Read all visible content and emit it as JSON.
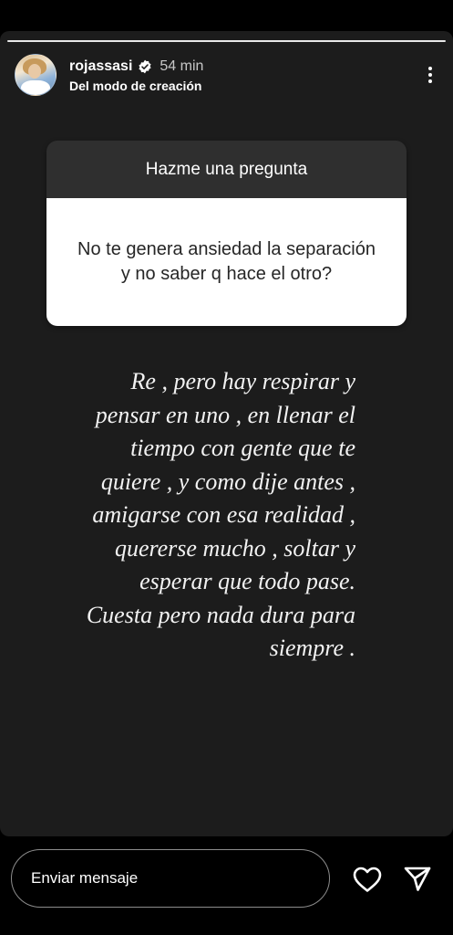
{
  "story": {
    "progress_segments": 1,
    "username": "rojassasi",
    "verified": true,
    "time_ago": "54 min",
    "subtitle": "Del modo de creación",
    "menu_icon": "more-vertical-icon"
  },
  "question_sticker": {
    "title": "Hazme una pregunta",
    "question": "No te genera ansiedad la separación y no saber q hace el otro?"
  },
  "answer_lines": [
    "Re , pero hay respirar y",
    "pensar en uno , en llenar el",
    "tiempo con gente que te",
    "quiere ,  y como dije antes ,",
    "amigarse con esa realidad  ,",
    "quererse mucho , soltar y",
    "esperar que todo pase.",
    "Cuesta pero nada dura para",
    "siempre ."
  ],
  "reply_bar": {
    "placeholder": "Enviar mensaje",
    "like_icon": "heart-icon",
    "send_icon": "send-icon"
  },
  "colors": {
    "background": "#000000",
    "story_background": "#1c1c1c",
    "sticker_header": "#2f2f2f",
    "sticker_body": "#ffffff",
    "verified_badge": "#ffffff"
  }
}
